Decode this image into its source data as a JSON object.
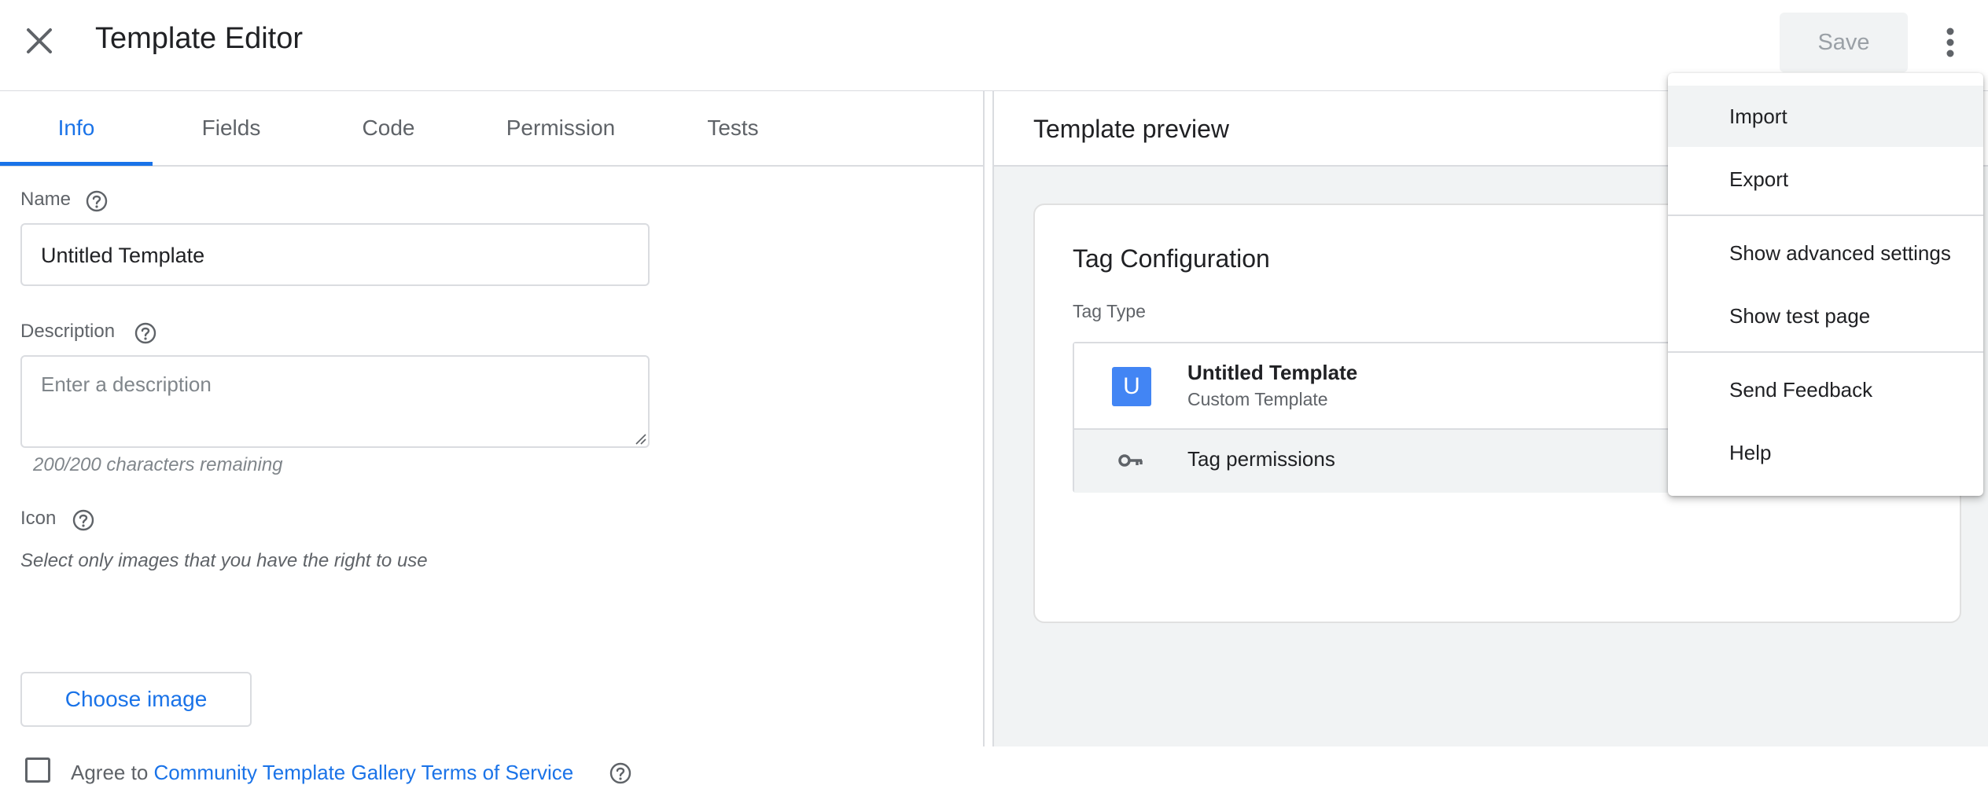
{
  "header": {
    "title": "Template Editor",
    "save_label": "Save",
    "close_icon": "close-icon",
    "more_icon": "more-vert-icon"
  },
  "tabs": [
    {
      "label": "Info",
      "active": true
    },
    {
      "label": "Fields",
      "active": false
    },
    {
      "label": "Code",
      "active": false
    },
    {
      "label": "Permission",
      "active": false
    },
    {
      "label": "Tests",
      "active": false
    }
  ],
  "form": {
    "name_label": "Name",
    "name_value": "Untitled Template",
    "description_label": "Description",
    "description_placeholder": "Enter a description",
    "char_remaining": "200/200 characters remaining",
    "icon_label": "Icon",
    "icon_hint": "Select only images that you have the right to use",
    "choose_image": "Choose image",
    "agree_prefix": "Agree to",
    "tos_link": "Community Template Gallery Terms of Service"
  },
  "preview": {
    "title": "Template preview",
    "card_title": "Tag Configuration",
    "tag_type_label": "Tag Type",
    "badge_letter": "U",
    "tag_name": "Untitled Template",
    "tag_desc": "Custom Template",
    "permissions_label": "Tag permissions"
  },
  "menu": {
    "items": [
      "Import",
      "Export",
      "Show advanced settings",
      "Show test page",
      "Send Feedback",
      "Help"
    ]
  },
  "colors": {
    "accent": "#1a73e8",
    "badge": "#4285f4",
    "panel_bg": "#f1f3f4",
    "border": "#dadce0"
  }
}
